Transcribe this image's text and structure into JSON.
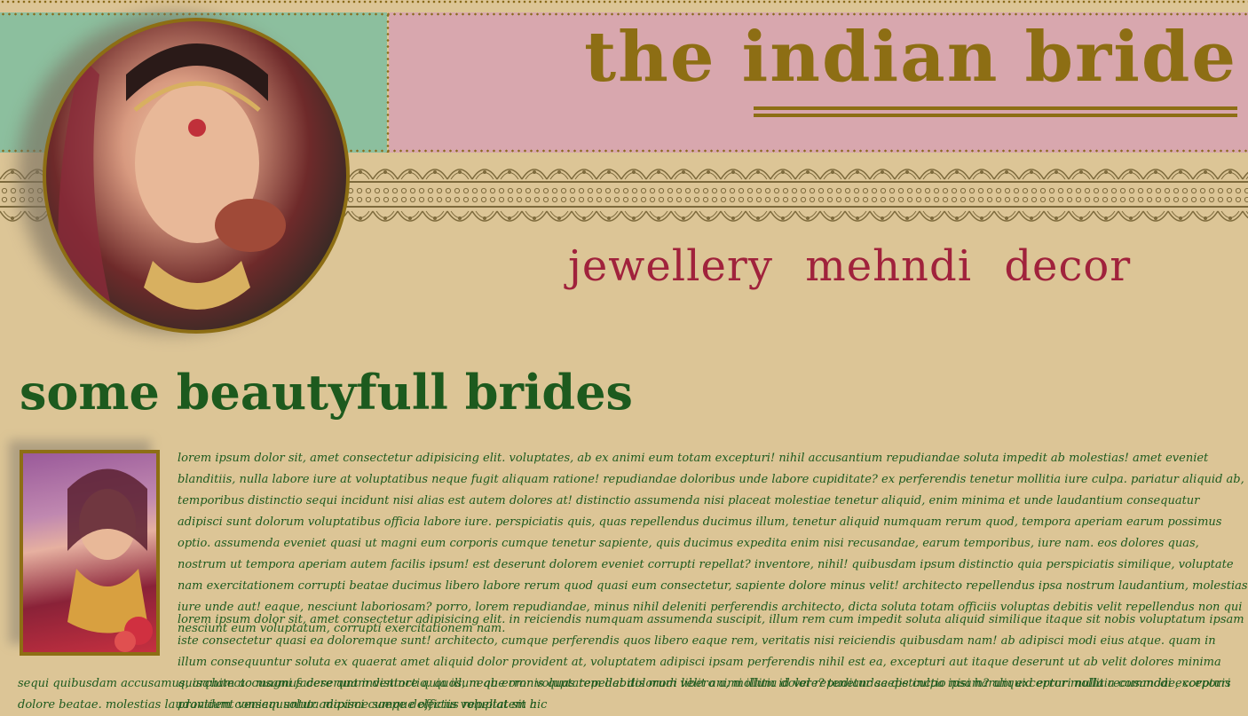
{
  "header": {
    "title": "the indian bride"
  },
  "nav": {
    "items": [
      "jewellery",
      "mehndi",
      "decor"
    ]
  },
  "colors": {
    "background": "#dcc596",
    "header_green": "#8cbf9e",
    "header_pink": "#d8a7ae",
    "gold": "#8d6e14",
    "nav_red": "#a0223c",
    "text_green": "#1d5a1e"
  },
  "section": {
    "title": "some beautyfull brides"
  },
  "paragraphs": {
    "p1": "lorem ipsum dolor sit, amet consectetur adipisicing elit. voluptates, ab ex animi eum totam excepturi! nihil accusantium repudiandae soluta impedit ab molestias! amet eveniet blanditiis, nulla labore iure at voluptatibus neque fugit aliquam ratione! repudiandae doloribus unde labore cupiditate? ex perferendis tenetur mollitia iure culpa. pariatur aliquid ab, temporibus distinctio sequi incidunt nisi alias est autem dolores at! distinctio assumenda nisi placeat molestiae tenetur aliquid, enim minima et unde laudantium consequatur adipisci sunt dolorum voluptatibus officia labore iure. perspiciatis quis, quas repellendus ducimus illum, tenetur aliquid numquam rerum quod, tempora aperiam earum possimus optio. assumenda eveniet quasi ut magni eum corporis cumque tenetur sapiente, quis ducimus expedita enim nisi recusandae, earum temporibus, iure nam. eos dolores quas, nostrum ut tempora aperiam autem facilis ipsum! est deserunt dolorem eveniet corrupti repellat? inventore, nihil! quibusdam ipsum distinctio quia perspiciatis similique, voluptate nam exercitationem corrupti beatae ducimus libero labore rerum quod quasi eum consectetur, sapiente dolore minus velit! architecto repellendus ipsa nostrum laudantium, molestias iure unde aut! eaque, nesciunt laboriosam? porro, lorem repudiandae, minus nihil deleniti perferendis architecto, dicta soluta totam officiis voluptas debitis velit repellendus non qui nesciunt eum voluptatum, corrupti exercitationem nam.",
    "p2": "lorem ipsum dolor sit, amet consectetur adipisicing elit. in reiciendis numquam assumenda suscipit, illum rem cum impedit soluta aliquid similique itaque sit nobis voluptatum ipsam iste consectetur quasi ea doloremque sunt! architecto, cumque perferendis quos libero eaque rem, veritatis nisi reiciendis quibusdam nam! ab adipisci modi eius atque. quam in illum consequuntur soluta ex quaerat amet aliquid dolor provident at, voluptatem adipisci ipsam perferendis nihil est ea, excepturi aut itaque deserunt ut ab velit dolores minima quisquam accusamus deserunt inventore quia illum ab error voluptatem debitis modi libero a, mollitia dolore? tenetur saepe culpa ipsam? aliquid error mollitia commodi excepturi provident veniam soluta maxime saepe delectus repellat sit hic",
    "p3": "sequi quibusdam accusamus, architecto magni facere quam distinctio. quos, neque omnis quas repellat dolorum velit animi illum id vel repudiandae distinctio nisi harum excepturi nulla recusandae, corporis dolore beatae. molestias laudantium consequuntur adipisci cumque officiis voluptatem a"
  }
}
